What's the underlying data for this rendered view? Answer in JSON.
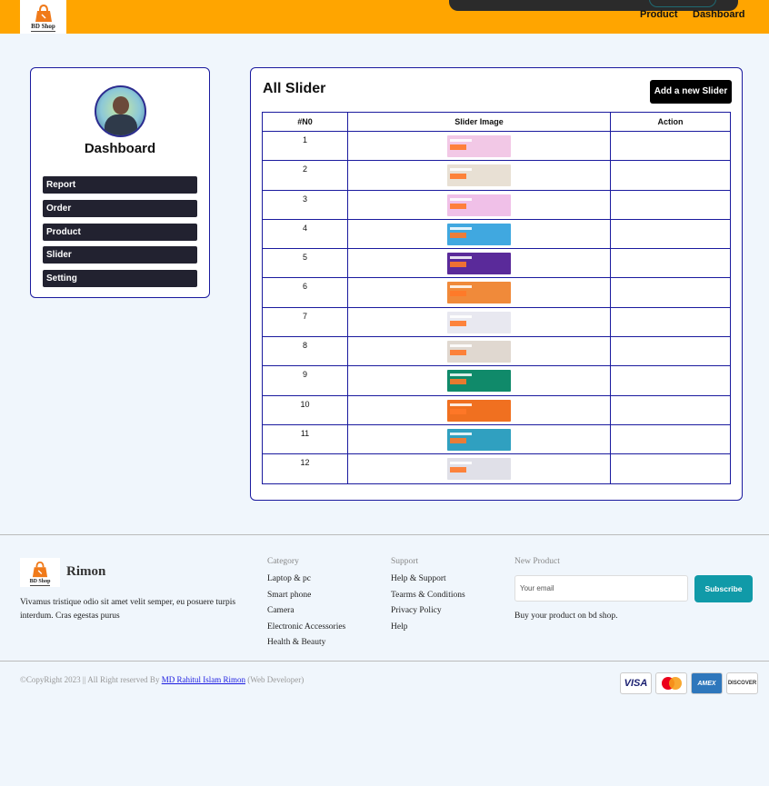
{
  "header": {
    "logo_text": "BD Shop",
    "nav": [
      "Product",
      "Dashboard"
    ]
  },
  "sidebar": {
    "title": "Dashboard",
    "items": [
      "Report",
      "Order",
      "Product",
      "Slider",
      "Setting"
    ]
  },
  "main": {
    "title": "All Slider",
    "add_button": "Add a new Slider",
    "columns": [
      "#N0",
      "Slider Image",
      "Action"
    ],
    "rows": [
      {
        "no": "1",
        "color": "#f2c8e6"
      },
      {
        "no": "2",
        "color": "#e8e0d4"
      },
      {
        "no": "3",
        "color": "#f0c0e8"
      },
      {
        "no": "4",
        "color": "#40a8e0"
      },
      {
        "no": "5",
        "color": "#5a2a9a"
      },
      {
        "no": "6",
        "color": "#f08a3a"
      },
      {
        "no": "7",
        "color": "#e8e8f0"
      },
      {
        "no": "8",
        "color": "#e0d8d0"
      },
      {
        "no": "9",
        "color": "#108a6a"
      },
      {
        "no": "10",
        "color": "#f07020"
      },
      {
        "no": "11",
        "color": "#30a0c0"
      },
      {
        "no": "12",
        "color": "#e0e0e8"
      }
    ]
  },
  "footer": {
    "logo_text": "BD Shop",
    "name": "Rimon",
    "description": "Vivamus tristique odio sit amet velit semper, eu posuere turpis interdum. Cras egestas purus",
    "category": {
      "title": "Category",
      "links": [
        "Laptop & pc",
        "Smart phone",
        "Camera",
        "Electronic Accessories",
        "Health & Beauty"
      ]
    },
    "support": {
      "title": "Support",
      "links": [
        "Help & Support",
        "Tearms & Conditions",
        "Privacy Policy",
        "Help"
      ]
    },
    "new_product": {
      "title": "New Product",
      "email_placeholder": "Your email",
      "subscribe_label": "Subscribe",
      "note": "Buy your product on bd shop."
    },
    "copyright_prefix": "©CopyRight 2023 || All Right reserved By ",
    "copyright_author": "MD Rahitul Islam Rimon",
    "copyright_suffix": " (Web Developer)",
    "cards": [
      "VISA",
      "AMEX",
      "DISCOVER"
    ],
    "colors": {
      "accent": "#ffa500",
      "border": "#1a1a9e",
      "subscribe": "#109aa8"
    }
  }
}
